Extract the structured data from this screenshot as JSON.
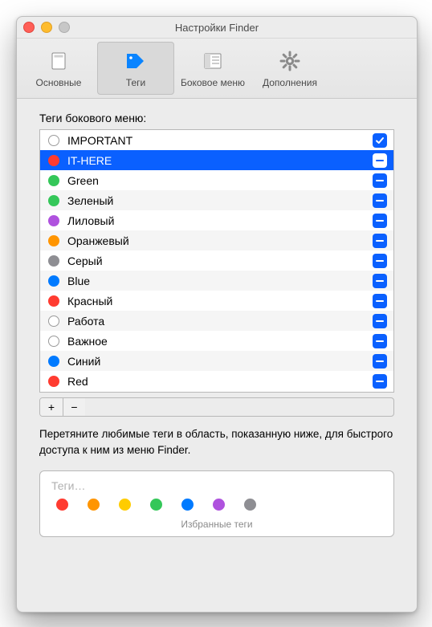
{
  "window": {
    "title": "Настройки Finder",
    "close_enabled": true,
    "minimize_enabled": true,
    "zoom_enabled": false
  },
  "toolbar": {
    "tabs": [
      {
        "id": "general",
        "label": "Основные",
        "selected": false
      },
      {
        "id": "tags",
        "label": "Теги",
        "selected": true
      },
      {
        "id": "sidebar",
        "label": "Боковое меню",
        "selected": false
      },
      {
        "id": "advanced",
        "label": "Дополнения",
        "selected": false
      }
    ]
  },
  "tags_section": {
    "heading": "Теги бокового меню:",
    "tags": [
      {
        "name": "IMPORTANT",
        "color": "none",
        "state": "checked",
        "selected": false
      },
      {
        "name": "IT-HERE",
        "color": "#ff3b30",
        "state": "minus",
        "selected": true
      },
      {
        "name": "Green",
        "color": "#34c759",
        "state": "minus",
        "selected": false
      },
      {
        "name": "Зеленый",
        "color": "#34c759",
        "state": "minus",
        "selected": false
      },
      {
        "name": "Лиловый",
        "color": "#af52de",
        "state": "minus",
        "selected": false
      },
      {
        "name": "Оранжевый",
        "color": "#ff9500",
        "state": "minus",
        "selected": false
      },
      {
        "name": "Серый",
        "color": "#8e8e93",
        "state": "minus",
        "selected": false
      },
      {
        "name": "Blue",
        "color": "#007aff",
        "state": "minus",
        "selected": false
      },
      {
        "name": "Красный",
        "color": "#ff3b30",
        "state": "minus",
        "selected": false
      },
      {
        "name": "Работа",
        "color": "none",
        "state": "minus",
        "selected": false
      },
      {
        "name": "Важное",
        "color": "none",
        "state": "minus",
        "selected": false
      },
      {
        "name": "Синий",
        "color": "#007aff",
        "state": "minus",
        "selected": false
      },
      {
        "name": "Red",
        "color": "#ff3b30",
        "state": "minus",
        "selected": false
      }
    ],
    "add_label": "+",
    "remove_label": "−",
    "hint": "Перетяните любимые теги в область, показанную ниже, для быстрого доступа к ним из меню Finder."
  },
  "favorites": {
    "placeholder": "Теги…",
    "caption": "Избранные теги",
    "colors": [
      "#ff3b30",
      "#ff9500",
      "#ffcc00",
      "#34c759",
      "#007aff",
      "#af52de",
      "#8e8e93"
    ]
  }
}
